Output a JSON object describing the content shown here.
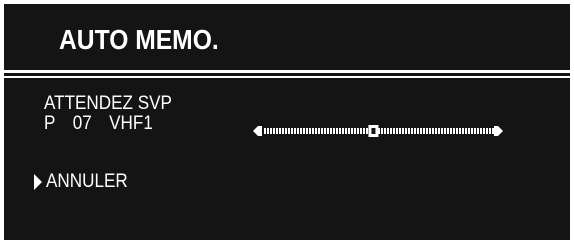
{
  "screen": {
    "title": "AUTO MEMO.",
    "status": {
      "message": "ATTENDEZ  SVP",
      "channel_prefix": "P",
      "channel_number": "07",
      "band": "VHF1"
    },
    "tuning_bar": {
      "position_fraction": 0.48
    },
    "menu": {
      "items": [
        {
          "label": "ANNULER",
          "selected": true
        }
      ]
    }
  },
  "colors": {
    "background": "#141414",
    "foreground": "#ffffff"
  }
}
